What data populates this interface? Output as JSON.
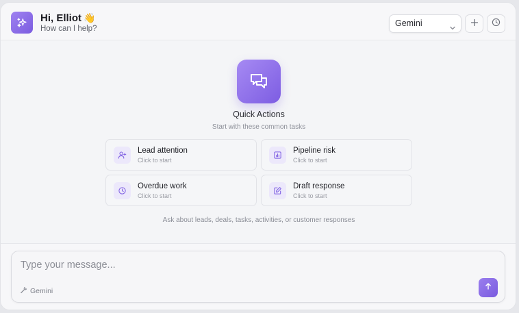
{
  "header": {
    "greeting": "Hi, Elliot",
    "wave_emoji": "👋",
    "subtitle": "How can I help?",
    "model_select": {
      "selected": "Gemini"
    },
    "new_chat_icon": "plus-icon",
    "history_icon": "clock-icon"
  },
  "quick_actions": {
    "icon": "chat-bubbles-icon",
    "title": "Quick Actions",
    "subtitle": "Start with these common tasks",
    "cards": [
      {
        "title": "Lead attention",
        "sub": "Click to start",
        "icon": "user-plus-icon"
      },
      {
        "title": "Pipeline risk",
        "sub": "Click to start",
        "icon": "bar-chart-icon"
      },
      {
        "title": "Overdue work",
        "sub": "Click to start",
        "icon": "clock-icon"
      },
      {
        "title": "Draft response",
        "sub": "Click to start",
        "icon": "edit-icon"
      }
    ],
    "hint": "Ask about leads, deals, tasks, activities, or customer responses"
  },
  "composer": {
    "placeholder": "Type your message...",
    "model_label": "Gemini",
    "send_icon": "arrow-up-icon"
  },
  "colors": {
    "accent": "#7d5de2",
    "accent_light": "#ece8fb"
  }
}
